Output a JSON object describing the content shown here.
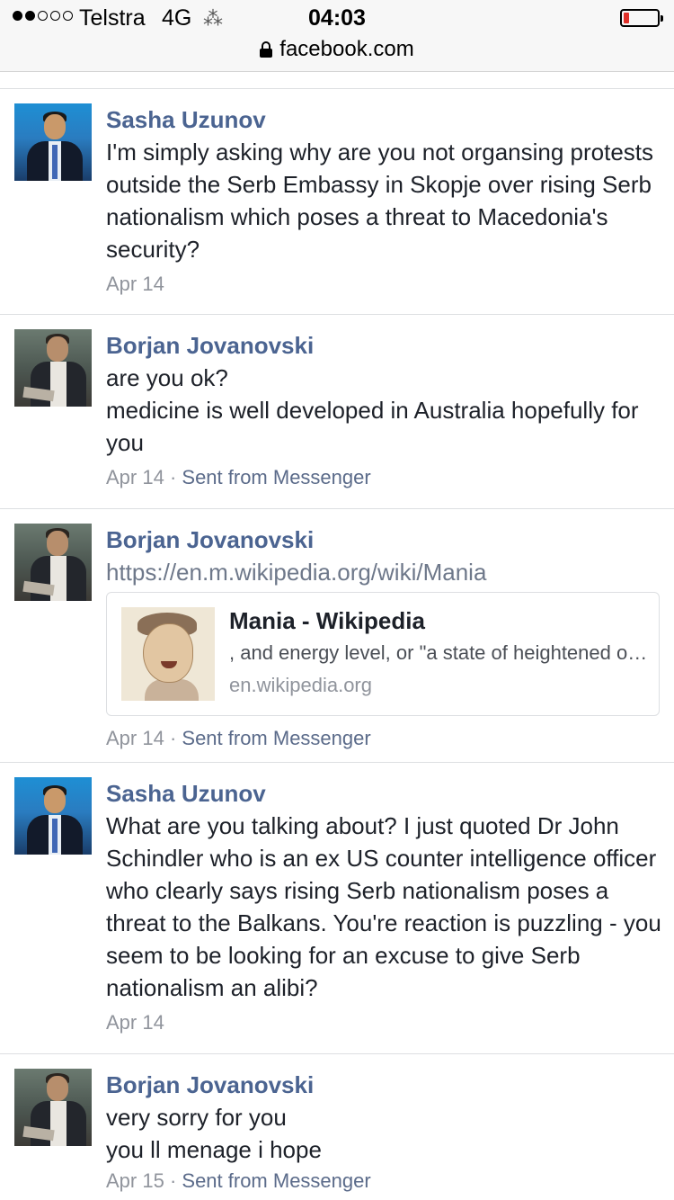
{
  "status_bar": {
    "carrier": "Telstra",
    "network": "4G",
    "time": "04:03",
    "signal_bars_filled": 2,
    "signal_bars_total": 5,
    "battery_color": "#e0312a"
  },
  "url_bar": {
    "domain": "facebook.com"
  },
  "messages": [
    {
      "author": "Sasha Uzunov",
      "text": "I'm simply asking why are you not organsing protests outside the Serb Embassy in Skopje over rising Serb nationalism which poses a threat to Macedonia's security?",
      "date": "Apr 14",
      "source": ""
    },
    {
      "author": "Borjan Jovanovski",
      "text": "are you ok?\nmedicine is well developed in Australia hopefully for you",
      "date": "Apr 14",
      "separator": " · ",
      "source": "Sent from Messenger"
    },
    {
      "author": "Borjan Jovanovski",
      "link": "https://en.m.wikipedia.org/wiki/Mania",
      "card": {
        "title": "Mania - Wikipedia",
        "description": ", and energy level, or \"a state of heightened overall activation with enhanced affective expression\"",
        "host": "en.wikipedia.org"
      },
      "date": "Apr 14",
      "separator": " · ",
      "source": "Sent from Messenger"
    },
    {
      "author": "Sasha Uzunov",
      "text": "What are you talking about? I just quoted Dr John Schindler who is an ex US counter intelligence officer who clearly says rising Serb nationalism poses a threat to the Balkans. You're reaction is puzzling - you seem to be looking for an excuse to give Serb nationalism an alibi?",
      "date": "Apr 14",
      "source": ""
    },
    {
      "author": "Borjan Jovanovski",
      "text": "very sorry for you\nyou ll menage i hope",
      "date": "Apr 15",
      "separator": " · ",
      "source": "Sent from Messenger"
    }
  ]
}
